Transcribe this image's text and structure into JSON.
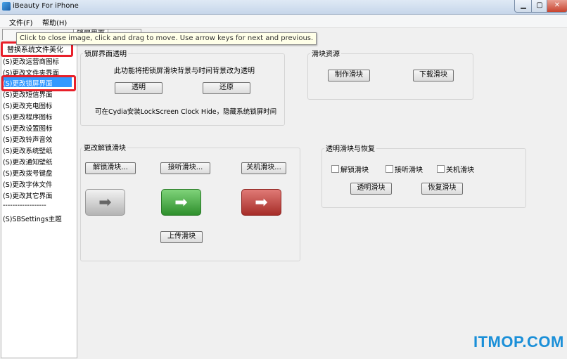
{
  "window": {
    "title": "iBeauty For iPhone",
    "min_glyph": "▁",
    "max_glyph": "▢",
    "close_glyph": "✕"
  },
  "menu": {
    "file": "文件(F)",
    "help": "帮助(H)"
  },
  "tabs": {
    "tab2": "锁屏界面",
    "tab3": ""
  },
  "tooltip": "Click to close image, click and drag to move. Use arrow keys for next and previous.",
  "sidebar": {
    "items": [
      "替换系统文件美化",
      "(S)更改运营商图标",
      "(S)更改文件夹界面",
      "(S)更改锁屏界面",
      "(S)更改短信界面",
      "(S)更改充电图标",
      "(S)更改程序图标",
      "(S)更改设置图标",
      "(S)更改铃声音效",
      "(S)更改系统壁纸",
      "(S)更改通知壁纸",
      "(S)更改拨号键盘",
      "(S)更改字体文件",
      "(S)更改其它界面",
      "------------------",
      "(S)SBSettings主题"
    ]
  },
  "lock_panel": {
    "title": "锁屏界面透明",
    "desc": "此功能将把锁屏滑块背景与时间背景改为透明",
    "transparent_btn": "透明",
    "restore_btn": "还原",
    "note": "可在Cydia安装LockScreen Clock Hide，隐藏系统锁屏时间"
  },
  "slider_res": {
    "title": "滑块资源",
    "make_btn": "制作滑块",
    "download_btn": "下载滑块"
  },
  "change_slider": {
    "title": "更改解锁滑块",
    "unlock_btn": "解锁滑块...",
    "answer_btn": "接听滑块...",
    "poweroff_btn": "关机滑块...",
    "upload_btn": "上传滑块",
    "arrow": "➡"
  },
  "transp_slider": {
    "title": "透明滑块与恢复",
    "cb_unlock": "解锁滑块",
    "cb_answer": "接听滑块",
    "cb_poweroff": "关机滑块",
    "transparent_btn": "透明滑块",
    "restore_btn": "恢复滑块"
  },
  "watermark": "ITMOP.COM",
  "colors": {
    "selection": "#3399ff",
    "highlight_box": "#e8202a",
    "watermark": "#1a8fd8"
  }
}
